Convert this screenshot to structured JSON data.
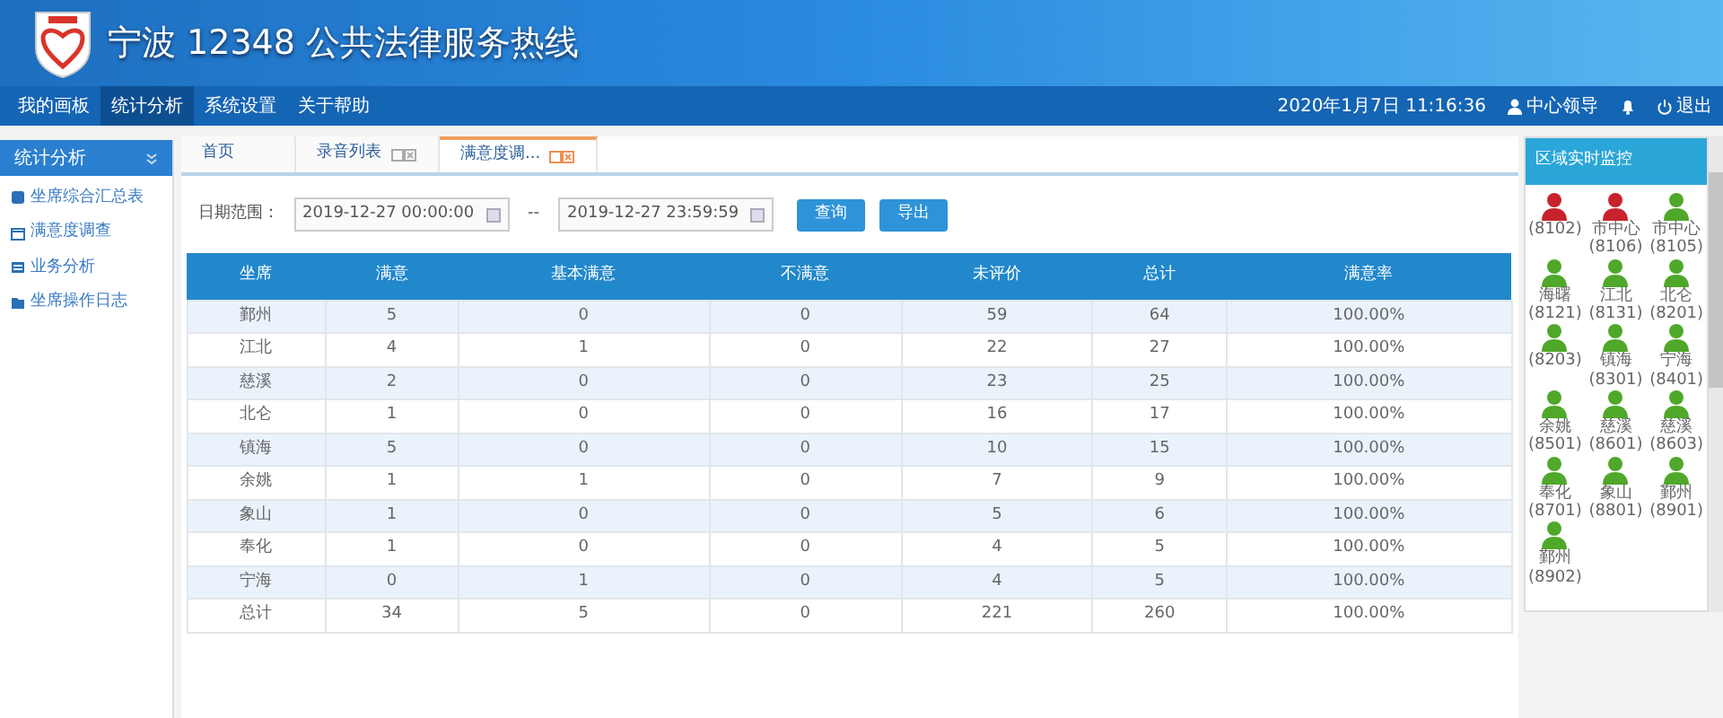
{
  "header": {
    "title": "宁波 12348 公共法律服务热线"
  },
  "menu": [
    {
      "label": "我的画板",
      "selected": false
    },
    {
      "label": "统计分析",
      "selected": true
    },
    {
      "label": "系统设置",
      "selected": false
    },
    {
      "label": "关于帮助",
      "selected": false
    }
  ],
  "status": {
    "datetime": "2020年1月7日 11:16:36",
    "user": "中心领导",
    "logout": "退出"
  },
  "sidebar": {
    "title": "统计分析",
    "items": [
      {
        "label": "坐席综合汇总表"
      },
      {
        "label": "满意度调查"
      },
      {
        "label": "业务分析"
      },
      {
        "label": "坐席操作日志"
      }
    ]
  },
  "tabs": [
    {
      "label": "首页",
      "selected": false,
      "closable": false
    },
    {
      "label": "录音列表",
      "selected": false,
      "closable": true
    },
    {
      "label": "满意度调...",
      "selected": true,
      "closable": true
    }
  ],
  "filter": {
    "label": "日期范围：",
    "start": "2019-12-27 00:00:00",
    "separator": "--",
    "end": "2019-12-27 23:59:59",
    "buttons": [
      "查询",
      "导出"
    ]
  },
  "table": {
    "columns": [
      "坐席",
      "满意",
      "基本满意",
      "不满意",
      "未评价",
      "总计",
      "满意率"
    ],
    "rows": [
      [
        "鄞州",
        "5",
        "0",
        "0",
        "59",
        "64",
        "100.00%"
      ],
      [
        "江北",
        "4",
        "1",
        "0",
        "22",
        "27",
        "100.00%"
      ],
      [
        "慈溪",
        "2",
        "0",
        "0",
        "23",
        "25",
        "100.00%"
      ],
      [
        "北仑",
        "1",
        "0",
        "0",
        "16",
        "17",
        "100.00%"
      ],
      [
        "镇海",
        "5",
        "0",
        "0",
        "10",
        "15",
        "100.00%"
      ],
      [
        "余姚",
        "1",
        "1",
        "0",
        "7",
        "9",
        "100.00%"
      ],
      [
        "象山",
        "1",
        "0",
        "0",
        "5",
        "6",
        "100.00%"
      ],
      [
        "奉化",
        "1",
        "0",
        "0",
        "4",
        "5",
        "100.00%"
      ],
      [
        "宁海",
        "0",
        "1",
        "0",
        "4",
        "5",
        "100.00%"
      ],
      [
        "总计",
        "34",
        "5",
        "0",
        "221",
        "260",
        "100.00%"
      ]
    ]
  },
  "monitor": {
    "title": "区域实时监控",
    "agents": [
      {
        "code": "(8102)",
        "color": "#c8232c"
      },
      {
        "name": "市中心",
        "code": "(8106)",
        "color": "#c8232c"
      },
      {
        "name": "市中心",
        "code": "(8105)",
        "color": "#4fa82a"
      },
      {
        "name": "海曙",
        "code": "(8121)",
        "color": "#4fa82a"
      },
      {
        "name": "江北",
        "code": "(8131)",
        "color": "#4fa82a"
      },
      {
        "name": "北仑",
        "code": "(8201)",
        "color": "#4fa82a"
      },
      {
        "code": "(8203)",
        "color": "#4fa82a"
      },
      {
        "name": "镇海",
        "code": "(8301)",
        "color": "#4fa82a"
      },
      {
        "name": "宁海",
        "code": "(8401)",
        "color": "#4fa82a"
      },
      {
        "name": "余姚",
        "code": "(8501)",
        "color": "#4fa82a"
      },
      {
        "name": "慈溪",
        "code": "(8601)",
        "color": "#4fa82a"
      },
      {
        "name": "慈溪",
        "code": "(8603)",
        "color": "#4fa82a"
      },
      {
        "name": "奉化",
        "code": "(8701)",
        "color": "#4fa82a"
      },
      {
        "name": "象山",
        "code": "(8801)",
        "color": "#4fa82a"
      },
      {
        "name": "鄞州",
        "code": "(8901)",
        "color": "#4fa82a"
      },
      {
        "name": "鄞州",
        "code": "(8902)",
        "color": "#4fa82a"
      }
    ]
  }
}
